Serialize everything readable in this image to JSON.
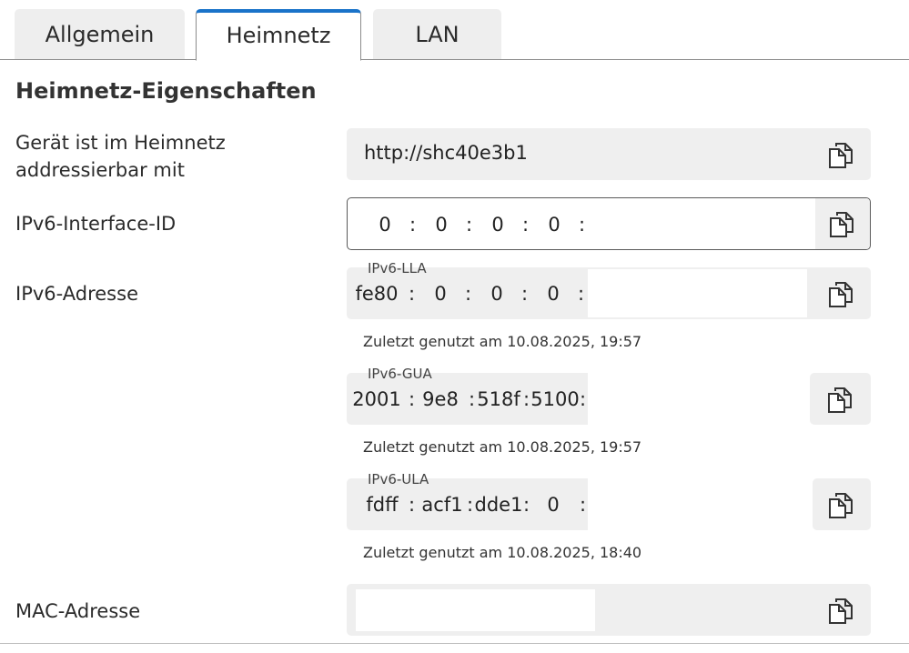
{
  "tabs": [
    {
      "label": "Allgemein",
      "active": false
    },
    {
      "label": "Heimnetz",
      "active": true
    },
    {
      "label": "LAN",
      "active": false
    }
  ],
  "section": {
    "title": "Heimnetz-Eigenschaften"
  },
  "rows": {
    "address": {
      "label": "Gerät ist im Heimnetz addressierbar mit",
      "value": "http://shc40e3b1"
    },
    "interface_id": {
      "label": "IPv6-Interface-ID",
      "segments": [
        "0",
        "0",
        "0",
        "0"
      ]
    },
    "ipv6": {
      "label": "IPv6-Adresse",
      "lla": {
        "subtitle": "IPv6-LLA",
        "segments": [
          "fe80",
          "0",
          "0",
          "0"
        ],
        "last_used": "Zuletzt genutzt am 10.08.2025, 19:57"
      },
      "gua": {
        "subtitle": "IPv6-GUA",
        "segments": [
          "2001",
          "9e8",
          "518f",
          "5100"
        ],
        "last_used": "Zuletzt genutzt am 10.08.2025, 19:57"
      },
      "ula": {
        "subtitle": "IPv6-ULA",
        "segments": [
          "fdff",
          "acf1",
          "dde1",
          "0"
        ],
        "last_used": "Zuletzt genutzt am 10.08.2025, 18:40"
      }
    },
    "mac": {
      "label": "MAC-Adresse"
    }
  },
  "icons": {
    "copy": "copy-icon"
  },
  "colors": {
    "tab_accent": "#1a73c9",
    "field_bg": "#efefef"
  }
}
